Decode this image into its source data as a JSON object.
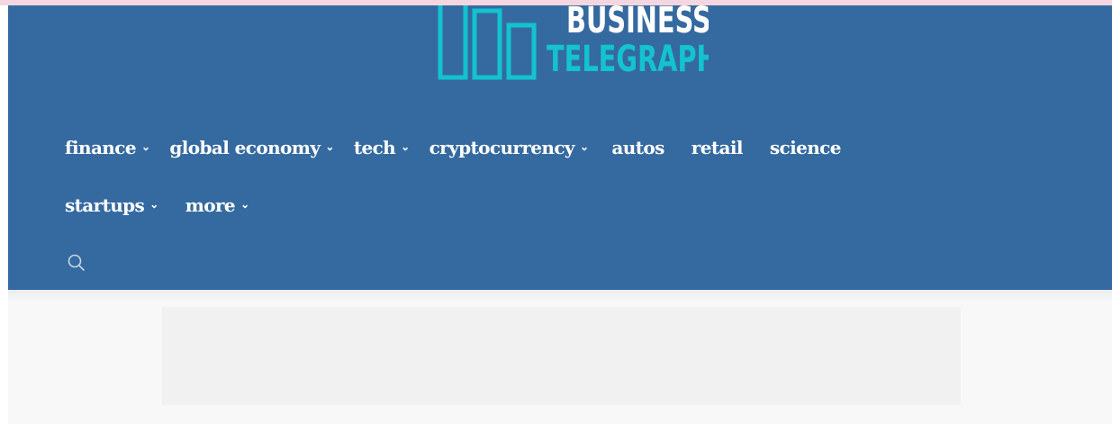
{
  "brand": {
    "name_line1": "BUSINESS",
    "name_line2": "TELEGRAPH",
    "accent_color": "#13c3ce",
    "header_bg": "#356aa0",
    "logo_icon": "bar-chart-icon"
  },
  "nav": {
    "row1": [
      {
        "label": "finance",
        "has_dropdown": true
      },
      {
        "label": "global economy",
        "has_dropdown": true
      },
      {
        "label": "tech",
        "has_dropdown": true
      },
      {
        "label": "cryptocurrency",
        "has_dropdown": true
      },
      {
        "label": "autos",
        "has_dropdown": false
      },
      {
        "label": "retail",
        "has_dropdown": false
      },
      {
        "label": "science",
        "has_dropdown": false
      }
    ],
    "row2": [
      {
        "label": "startups",
        "has_dropdown": true
      },
      {
        "label": "more",
        "has_dropdown": true
      }
    ],
    "dropdown_icon": "chevron-down-icon",
    "search_icon": "search-icon"
  }
}
